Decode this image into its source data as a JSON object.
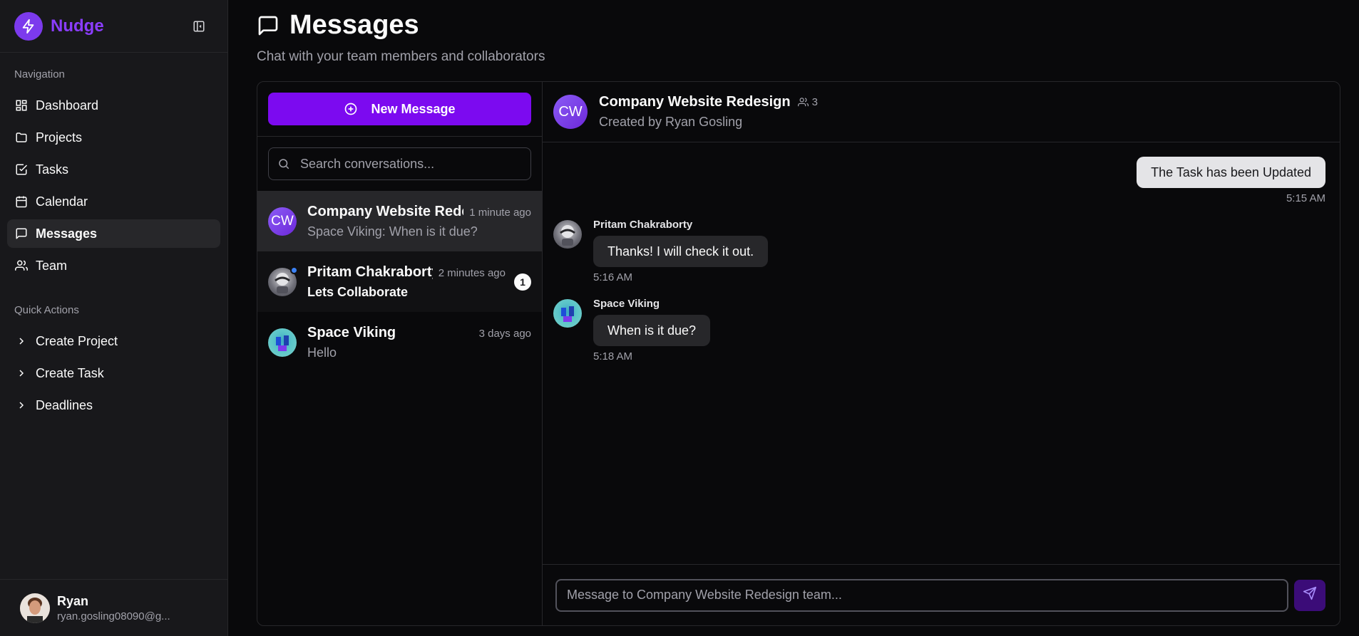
{
  "brand": {
    "name": "Nudge"
  },
  "sidebar": {
    "nav_label": "Navigation",
    "items": [
      {
        "label": "Dashboard",
        "icon": "dashboard-icon"
      },
      {
        "label": "Projects",
        "icon": "folder-icon"
      },
      {
        "label": "Tasks",
        "icon": "check-square-icon"
      },
      {
        "label": "Calendar",
        "icon": "calendar-icon"
      },
      {
        "label": "Messages",
        "icon": "message-square-icon",
        "active": true
      },
      {
        "label": "Team",
        "icon": "users-icon"
      }
    ],
    "quick_label": "Quick Actions",
    "quick_items": [
      {
        "label": "Create Project",
        "icon": "chevron-right-icon"
      },
      {
        "label": "Create Task",
        "icon": "chevron-right-icon"
      },
      {
        "label": "Deadlines",
        "icon": "chevron-right-icon"
      }
    ]
  },
  "user": {
    "name": "Ryan",
    "email": "ryan.gosling08090@g..."
  },
  "page": {
    "title": "Messages",
    "subtitle": "Chat with your team members and collaborators"
  },
  "conversations": {
    "new_button": "New Message",
    "search_placeholder": "Search conversations...",
    "items": [
      {
        "initials": "CW",
        "name": "Company Website Redesign",
        "time": "1 minute ago",
        "preview": "Space Viking: When is it due?",
        "active": true
      },
      {
        "name": "Pritam Chakraborty",
        "time": "2 minutes ago",
        "preview": "Lets Collaborate",
        "unread": "1",
        "online": true
      },
      {
        "name": "Space Viking",
        "time": "3 days ago",
        "preview": "Hello"
      }
    ]
  },
  "chat": {
    "initials": "CW",
    "title": "Company Website Redesign",
    "member_count": "3",
    "subtitle": "Created by Ryan Gosling",
    "messages": [
      {
        "type": "out",
        "text": "The Task has been Updated",
        "time": "5:15 AM"
      },
      {
        "type": "in",
        "sender": "Pritam Chakraborty",
        "text": "Thanks! I will check it out.",
        "time": "5:16 AM"
      },
      {
        "type": "in",
        "sender": "Space Viking",
        "text": "When is it due?",
        "time": "5:18 AM"
      }
    ],
    "composer_placeholder": "Message to Company Website Redesign team..."
  },
  "colors": {
    "accent": "#7c0af0",
    "brand": "#8b3dff",
    "background": "#09090b",
    "sidebar": "#18181b"
  }
}
